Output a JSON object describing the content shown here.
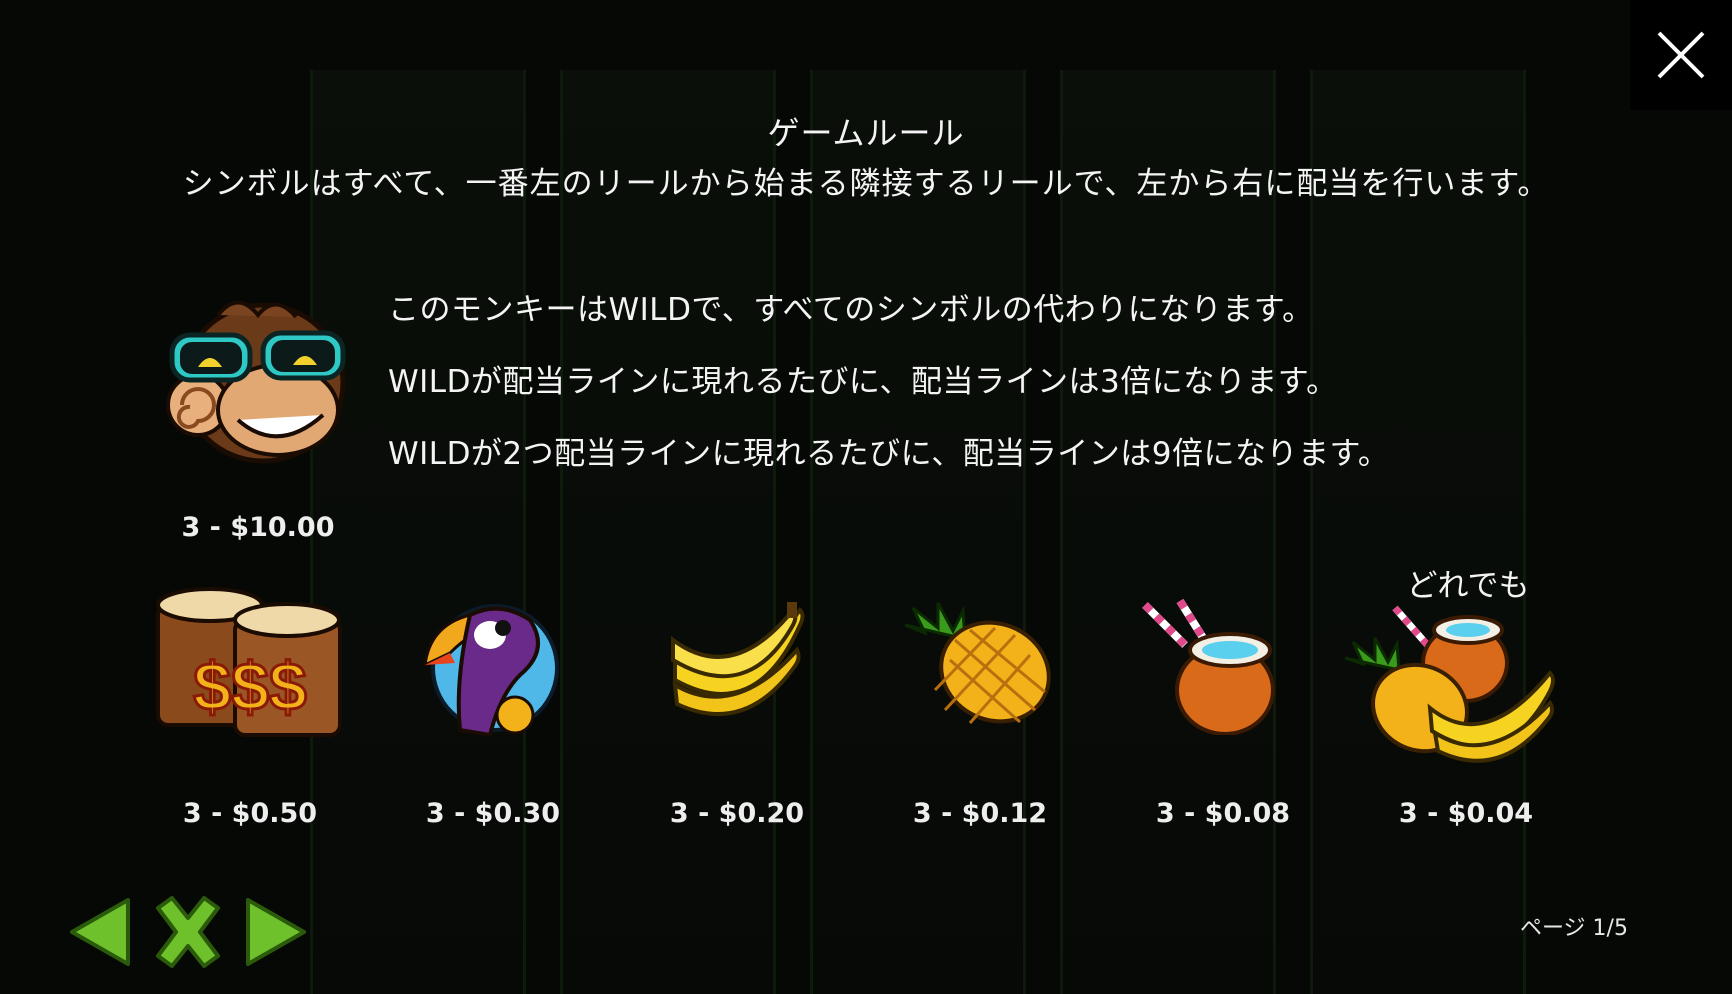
{
  "title": "ゲームルール",
  "rule": "シンボルはすべて、一番左のリールから始まる隣接するリールで、左から右に配当を行います。",
  "wild": {
    "lines": [
      "このモンキーはWILDで、すべてのシンボルの代わりになります。",
      "WILDが配当ラインに現れるたびに、配当ラインは3倍になります。",
      "WILDが2つ配当ラインに現れるたびに、配当ラインは9倍になります。"
    ],
    "payout": "3 - $10.00"
  },
  "symbols": [
    {
      "icon": "drums-dollar-icon",
      "payout": "3 - $0.50"
    },
    {
      "icon": "toucan-icon",
      "payout": "3 - $0.30"
    },
    {
      "icon": "banana-icon",
      "payout": "3 - $0.20"
    },
    {
      "icon": "pineapple-icon",
      "payout": "3 - $0.12"
    },
    {
      "icon": "coconut-drink-icon",
      "payout": "3 - $0.08"
    },
    {
      "icon": "mixed-fruit-icon",
      "payout": "3 - $0.04"
    }
  ],
  "any_label": "どれでも",
  "page_indicator": "ページ 1/5",
  "colors": {
    "nav_green": "#6fc12c",
    "background": "#060806",
    "text": "#f4f4f4"
  }
}
